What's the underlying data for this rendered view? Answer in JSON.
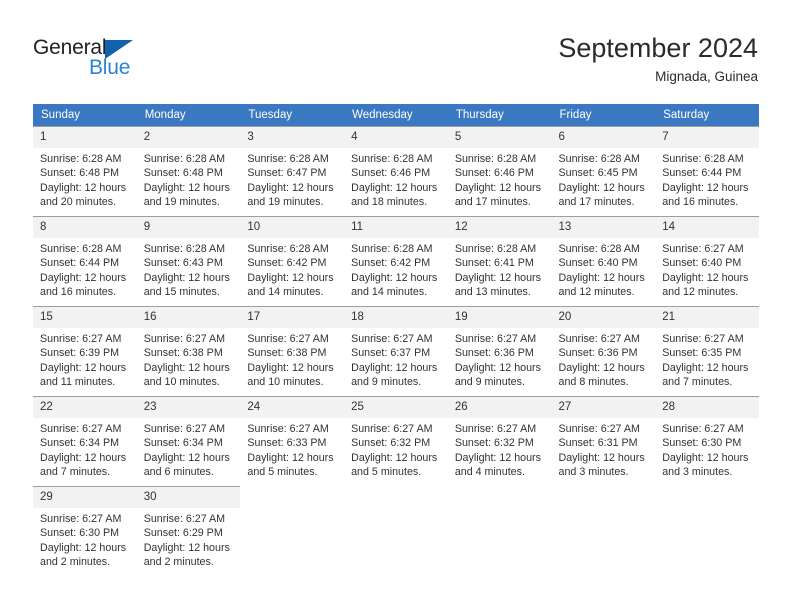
{
  "brand": {
    "name_primary": "General",
    "name_secondary": "Blue"
  },
  "header": {
    "title": "September 2024",
    "subtitle": "Mignada, Guinea"
  },
  "colors": {
    "header_row": "#3b78c2",
    "daynum_band": "#f2f2f2",
    "brand_blue": "#2a84d2",
    "brand_triangle": "#1362ad",
    "text": "#333333"
  },
  "weekdays": [
    "Sunday",
    "Monday",
    "Tuesday",
    "Wednesday",
    "Thursday",
    "Friday",
    "Saturday"
  ],
  "weeks": [
    [
      {
        "day": "1",
        "sunrise": "Sunrise: 6:28 AM",
        "sunset": "Sunset: 6:48 PM",
        "daylight1": "Daylight: 12 hours",
        "daylight2": "and 20 minutes."
      },
      {
        "day": "2",
        "sunrise": "Sunrise: 6:28 AM",
        "sunset": "Sunset: 6:48 PM",
        "daylight1": "Daylight: 12 hours",
        "daylight2": "and 19 minutes."
      },
      {
        "day": "3",
        "sunrise": "Sunrise: 6:28 AM",
        "sunset": "Sunset: 6:47 PM",
        "daylight1": "Daylight: 12 hours",
        "daylight2": "and 19 minutes."
      },
      {
        "day": "4",
        "sunrise": "Sunrise: 6:28 AM",
        "sunset": "Sunset: 6:46 PM",
        "daylight1": "Daylight: 12 hours",
        "daylight2": "and 18 minutes."
      },
      {
        "day": "5",
        "sunrise": "Sunrise: 6:28 AM",
        "sunset": "Sunset: 6:46 PM",
        "daylight1": "Daylight: 12 hours",
        "daylight2": "and 17 minutes."
      },
      {
        "day": "6",
        "sunrise": "Sunrise: 6:28 AM",
        "sunset": "Sunset: 6:45 PM",
        "daylight1": "Daylight: 12 hours",
        "daylight2": "and 17 minutes."
      },
      {
        "day": "7",
        "sunrise": "Sunrise: 6:28 AM",
        "sunset": "Sunset: 6:44 PM",
        "daylight1": "Daylight: 12 hours",
        "daylight2": "and 16 minutes."
      }
    ],
    [
      {
        "day": "8",
        "sunrise": "Sunrise: 6:28 AM",
        "sunset": "Sunset: 6:44 PM",
        "daylight1": "Daylight: 12 hours",
        "daylight2": "and 16 minutes."
      },
      {
        "day": "9",
        "sunrise": "Sunrise: 6:28 AM",
        "sunset": "Sunset: 6:43 PM",
        "daylight1": "Daylight: 12 hours",
        "daylight2": "and 15 minutes."
      },
      {
        "day": "10",
        "sunrise": "Sunrise: 6:28 AM",
        "sunset": "Sunset: 6:42 PM",
        "daylight1": "Daylight: 12 hours",
        "daylight2": "and 14 minutes."
      },
      {
        "day": "11",
        "sunrise": "Sunrise: 6:28 AM",
        "sunset": "Sunset: 6:42 PM",
        "daylight1": "Daylight: 12 hours",
        "daylight2": "and 14 minutes."
      },
      {
        "day": "12",
        "sunrise": "Sunrise: 6:28 AM",
        "sunset": "Sunset: 6:41 PM",
        "daylight1": "Daylight: 12 hours",
        "daylight2": "and 13 minutes."
      },
      {
        "day": "13",
        "sunrise": "Sunrise: 6:28 AM",
        "sunset": "Sunset: 6:40 PM",
        "daylight1": "Daylight: 12 hours",
        "daylight2": "and 12 minutes."
      },
      {
        "day": "14",
        "sunrise": "Sunrise: 6:27 AM",
        "sunset": "Sunset: 6:40 PM",
        "daylight1": "Daylight: 12 hours",
        "daylight2": "and 12 minutes."
      }
    ],
    [
      {
        "day": "15",
        "sunrise": "Sunrise: 6:27 AM",
        "sunset": "Sunset: 6:39 PM",
        "daylight1": "Daylight: 12 hours",
        "daylight2": "and 11 minutes."
      },
      {
        "day": "16",
        "sunrise": "Sunrise: 6:27 AM",
        "sunset": "Sunset: 6:38 PM",
        "daylight1": "Daylight: 12 hours",
        "daylight2": "and 10 minutes."
      },
      {
        "day": "17",
        "sunrise": "Sunrise: 6:27 AM",
        "sunset": "Sunset: 6:38 PM",
        "daylight1": "Daylight: 12 hours",
        "daylight2": "and 10 minutes."
      },
      {
        "day": "18",
        "sunrise": "Sunrise: 6:27 AM",
        "sunset": "Sunset: 6:37 PM",
        "daylight1": "Daylight: 12 hours",
        "daylight2": "and 9 minutes."
      },
      {
        "day": "19",
        "sunrise": "Sunrise: 6:27 AM",
        "sunset": "Sunset: 6:36 PM",
        "daylight1": "Daylight: 12 hours",
        "daylight2": "and 9 minutes."
      },
      {
        "day": "20",
        "sunrise": "Sunrise: 6:27 AM",
        "sunset": "Sunset: 6:36 PM",
        "daylight1": "Daylight: 12 hours",
        "daylight2": "and 8 minutes."
      },
      {
        "day": "21",
        "sunrise": "Sunrise: 6:27 AM",
        "sunset": "Sunset: 6:35 PM",
        "daylight1": "Daylight: 12 hours",
        "daylight2": "and 7 minutes."
      }
    ],
    [
      {
        "day": "22",
        "sunrise": "Sunrise: 6:27 AM",
        "sunset": "Sunset: 6:34 PM",
        "daylight1": "Daylight: 12 hours",
        "daylight2": "and 7 minutes."
      },
      {
        "day": "23",
        "sunrise": "Sunrise: 6:27 AM",
        "sunset": "Sunset: 6:34 PM",
        "daylight1": "Daylight: 12 hours",
        "daylight2": "and 6 minutes."
      },
      {
        "day": "24",
        "sunrise": "Sunrise: 6:27 AM",
        "sunset": "Sunset: 6:33 PM",
        "daylight1": "Daylight: 12 hours",
        "daylight2": "and 5 minutes."
      },
      {
        "day": "25",
        "sunrise": "Sunrise: 6:27 AM",
        "sunset": "Sunset: 6:32 PM",
        "daylight1": "Daylight: 12 hours",
        "daylight2": "and 5 minutes."
      },
      {
        "day": "26",
        "sunrise": "Sunrise: 6:27 AM",
        "sunset": "Sunset: 6:32 PM",
        "daylight1": "Daylight: 12 hours",
        "daylight2": "and 4 minutes."
      },
      {
        "day": "27",
        "sunrise": "Sunrise: 6:27 AM",
        "sunset": "Sunset: 6:31 PM",
        "daylight1": "Daylight: 12 hours",
        "daylight2": "and 3 minutes."
      },
      {
        "day": "28",
        "sunrise": "Sunrise: 6:27 AM",
        "sunset": "Sunset: 6:30 PM",
        "daylight1": "Daylight: 12 hours",
        "daylight2": "and 3 minutes."
      }
    ],
    [
      {
        "day": "29",
        "sunrise": "Sunrise: 6:27 AM",
        "sunset": "Sunset: 6:30 PM",
        "daylight1": "Daylight: 12 hours",
        "daylight2": "and 2 minutes."
      },
      {
        "day": "30",
        "sunrise": "Sunrise: 6:27 AM",
        "sunset": "Sunset: 6:29 PM",
        "daylight1": "Daylight: 12 hours",
        "daylight2": "and 2 minutes."
      },
      null,
      null,
      null,
      null,
      null
    ]
  ]
}
